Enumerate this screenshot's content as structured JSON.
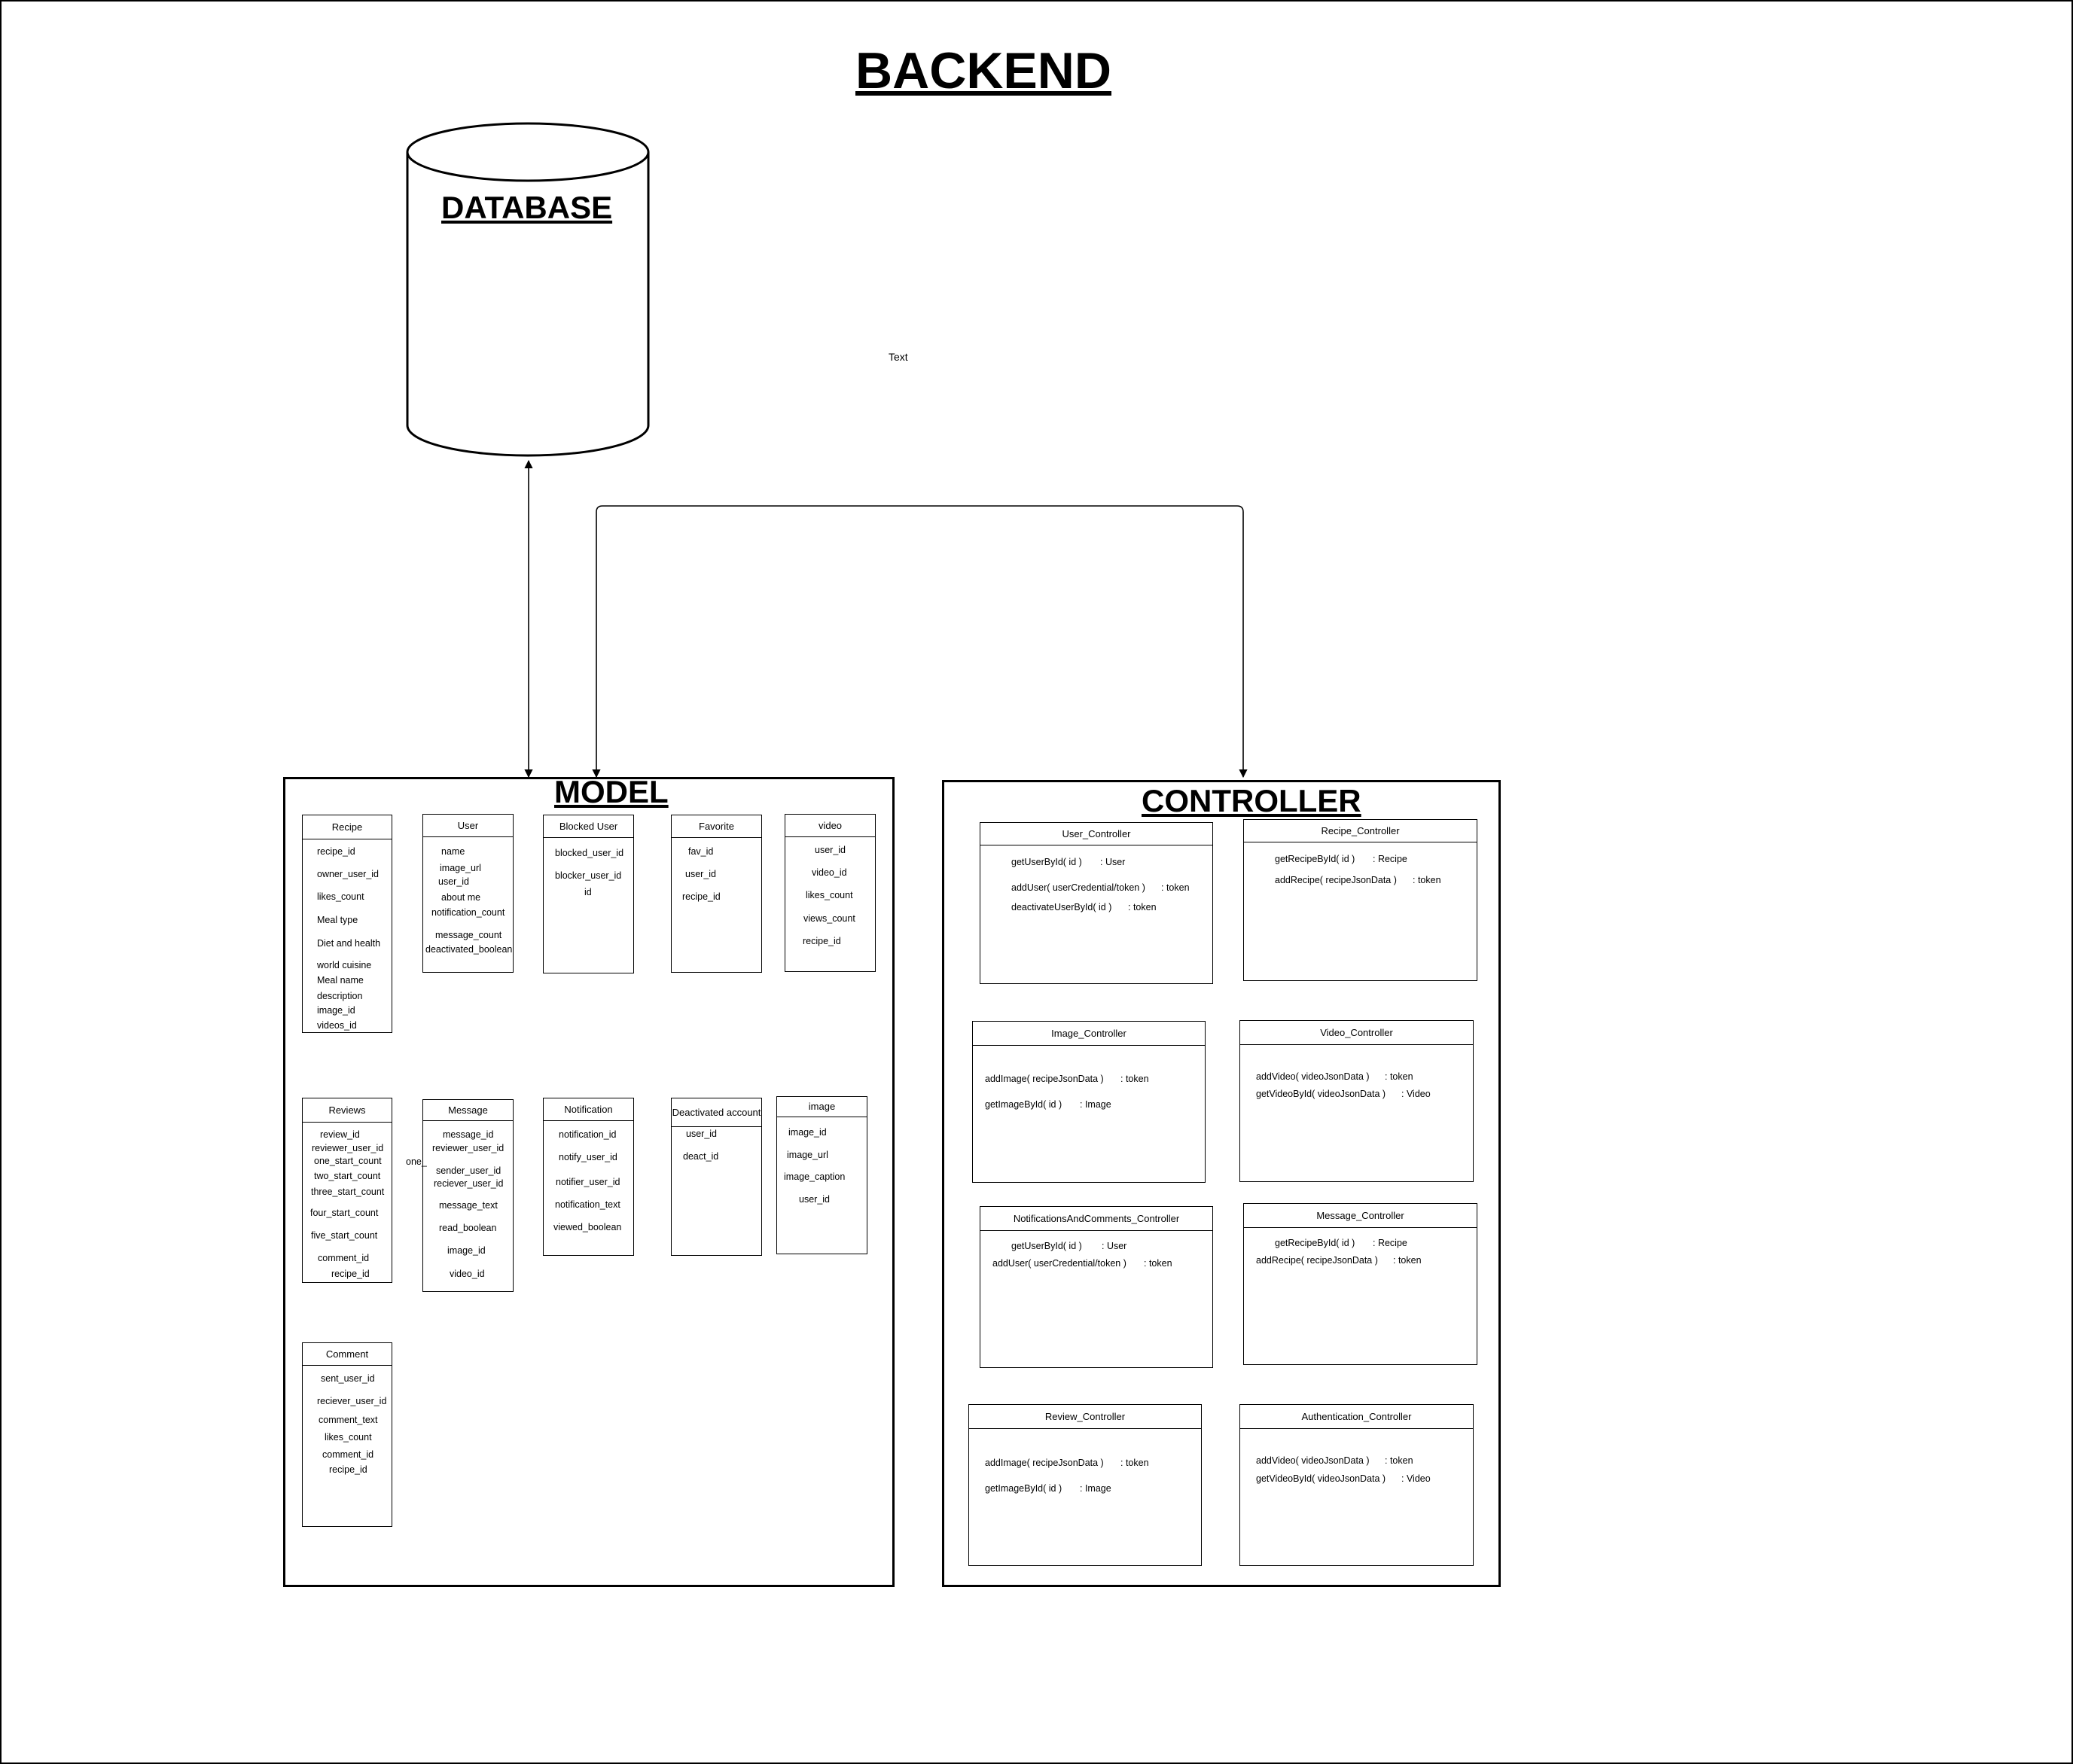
{
  "backend_title": "BACKEND",
  "database": {
    "label": "DATABASE"
  },
  "stray_text": "Text",
  "model": {
    "title": "MODEL",
    "entities": [
      {
        "name": "Recipe",
        "fields": [
          "recipe_id",
          "owner_user_id",
          "likes_count",
          "Meal type",
          "Diet and health",
          "world cuisine",
          "Meal name",
          "description",
          "image_id",
          "videos_id"
        ]
      },
      {
        "name": "User",
        "fields": [
          "name",
          "image_url",
          "user_id",
          "about me",
          "notification_count",
          "message_count",
          "deactivated_boolean"
        ]
      },
      {
        "name": "Blocked User",
        "fields": [
          "blocked_user_id",
          "blocker_user_id",
          "id"
        ]
      },
      {
        "name": "Favorite",
        "fields": [
          "fav_id",
          "user_id",
          "recipe_id"
        ]
      },
      {
        "name": "video",
        "fields": [
          "user_id",
          "video_id",
          "likes_count",
          "views_count",
          "recipe_id"
        ]
      },
      {
        "name": "Reviews",
        "fields": [
          "review_id",
          "reviewer_user_id",
          "one_start_count",
          "two_start_count",
          "three_start_count",
          "four_start_count",
          "five_start_count",
          "comment_id",
          "recipe_id"
        ]
      },
      {
        "name": "Message",
        "fields": [
          "message_id",
          "reviewer_user_id",
          "sender_user_id",
          "reciever_user_id",
          "message_text",
          "read_boolean",
          "image_id",
          "video_id"
        ]
      },
      {
        "name": "Notification",
        "fields": [
          "notification_id",
          "notify_user_id",
          "notifier_user_id",
          "notification_text",
          "viewed_boolean"
        ]
      },
      {
        "name": "Deactivated account",
        "fields": [
          "user_id",
          "deact_id"
        ]
      },
      {
        "name": "image",
        "fields": [
          "image_id",
          "image_url",
          "image_caption",
          "user_id"
        ]
      },
      {
        "name": "Comment",
        "fields": [
          "sent_user_id",
          "reciever_user_id",
          "comment_text",
          "likes_count",
          "comment_id",
          "recipe_id"
        ]
      }
    ],
    "overflow_text": "one_"
  },
  "controller": {
    "title": "CONTROLLER",
    "controllers": [
      {
        "name": "User_Controller",
        "methods": [
          {
            "sig": "getUserById( id )",
            "ret": ": User"
          },
          {
            "sig": "addUser( userCredential/token )",
            "ret": ": token"
          },
          {
            "sig": "deactivateUserById( id )",
            "ret": ": token"
          }
        ]
      },
      {
        "name": "Recipe_Controller",
        "methods": [
          {
            "sig": "getRecipeById( id )",
            "ret": ": Recipe"
          },
          {
            "sig": "addRecipe( recipeJsonData )",
            "ret": ": token"
          }
        ]
      },
      {
        "name": "Image_Controller",
        "methods": [
          {
            "sig": "addImage( recipeJsonData )",
            "ret": ": token"
          },
          {
            "sig": "getImageById( id )",
            "ret": ": Image"
          }
        ]
      },
      {
        "name": "Video_Controller",
        "methods": [
          {
            "sig": "addVideo( videoJsonData )",
            "ret": ": token"
          },
          {
            "sig": "getVideoById( videoJsonData )",
            "ret": ": Video"
          }
        ]
      },
      {
        "name": "NotificationsAndComments_Controller",
        "methods": [
          {
            "sig": "getUserById( id )",
            "ret": ": User"
          },
          {
            "sig": "addUser( userCredential/token )",
            "ret": ": token"
          }
        ]
      },
      {
        "name": "Message_Controller",
        "methods": [
          {
            "sig": "getRecipeById( id )",
            "ret": ": Recipe"
          },
          {
            "sig": "addRecipe( recipeJsonData )",
            "ret": ": token"
          }
        ]
      },
      {
        "name": "Review_Controller",
        "methods": [
          {
            "sig": "addImage( recipeJsonData )",
            "ret": ": token"
          },
          {
            "sig": "getImageById( id )",
            "ret": ": Image"
          }
        ]
      },
      {
        "name": "Authentication_Controller",
        "methods": [
          {
            "sig": "addVideo( videoJsonData )",
            "ret": ": token"
          },
          {
            "sig": "getVideoById( videoJsonData )",
            "ret": ": Video"
          }
        ]
      }
    ]
  },
  "connectors": [
    {
      "from": "database",
      "to": "model",
      "arrows": "both"
    },
    {
      "from": "model",
      "to": "controller",
      "arrows": "both"
    }
  ]
}
